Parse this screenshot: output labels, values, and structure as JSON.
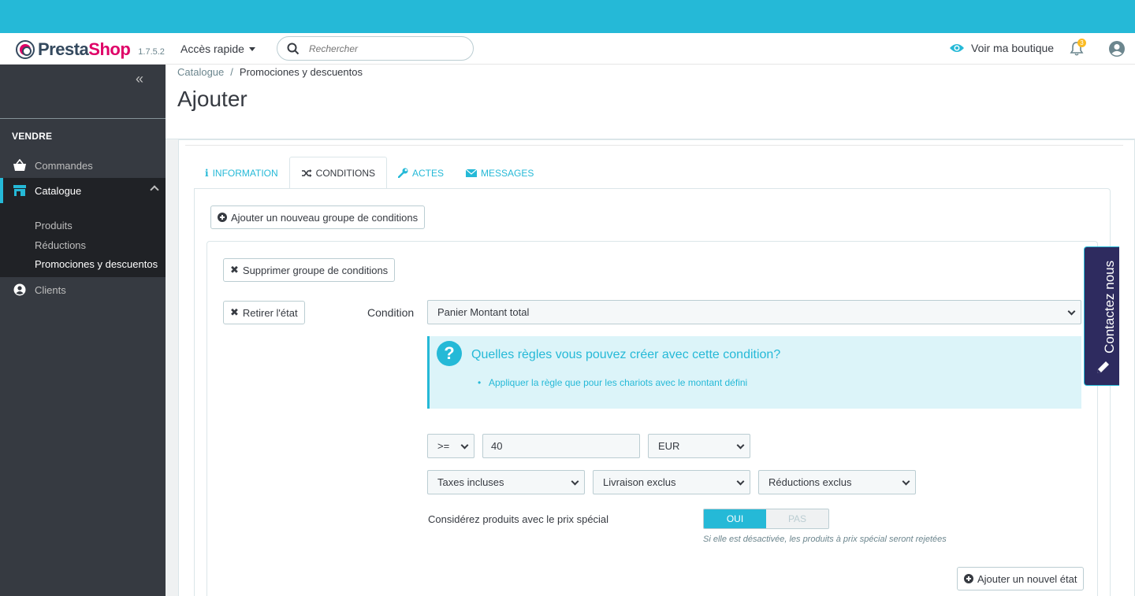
{
  "header": {
    "brand_a": "Presta",
    "brand_b": "Shop",
    "version": "1.7.5.2",
    "quick_access": "Accès rapide",
    "search_placeholder": "Rechercher",
    "view_shop": "Voir ma boutique",
    "notification_count": "3"
  },
  "sidebar": {
    "section": "VENDRE",
    "items": [
      {
        "label": "Commandes",
        "icon": "basket-icon"
      },
      {
        "label": "Catalogue",
        "icon": "store-icon"
      },
      {
        "label": "Clients",
        "icon": "user-icon"
      }
    ],
    "submenu": [
      "Produits",
      "Réductions",
      "Promociones y descuentos"
    ]
  },
  "breadcrumb": {
    "parent": "Catalogue",
    "current": "Promociones y descuentos"
  },
  "page_title": "Ajouter",
  "tabs": [
    {
      "label": "INFORMATION",
      "icon": "info-icon"
    },
    {
      "label": "CONDITIONS",
      "icon": "shuffle-icon"
    },
    {
      "label": "ACTES",
      "icon": "wrench-icon"
    },
    {
      "label": "MESSAGES",
      "icon": "envelope-icon"
    }
  ],
  "conditions": {
    "add_group_btn": "Ajouter un nouveau groupe de conditions",
    "delete_group_btn": "Supprimer groupe de conditions",
    "remove_state_btn": "Retirer l'état",
    "condition_label": "Condition",
    "condition_value": "Panier Montant total",
    "info_title": "Quelles règles vous pouvez créer avec cette condition?",
    "info_item": "Appliquer la règle que pour les chariots avec le montant défini",
    "operator": ">=",
    "amount": "40",
    "currency": "EUR",
    "taxes": "Taxes incluses",
    "shipping": "Livraison exclus",
    "reductions": "Réductions exclus",
    "special_price_label": "Considérez produits avec le prix spécial",
    "switch_on": "OUI",
    "switch_off": "PAS",
    "switch_help": "Si elle est désactivée, les produits à prix spécial seront rejetées",
    "add_state_btn": "Ajouter un nouvel état"
  },
  "contact_tab": "Contactez nous",
  "colors": {
    "accent": "#25b9d7",
    "sidebar": "#363a41",
    "brand_pink": "#df0067"
  }
}
